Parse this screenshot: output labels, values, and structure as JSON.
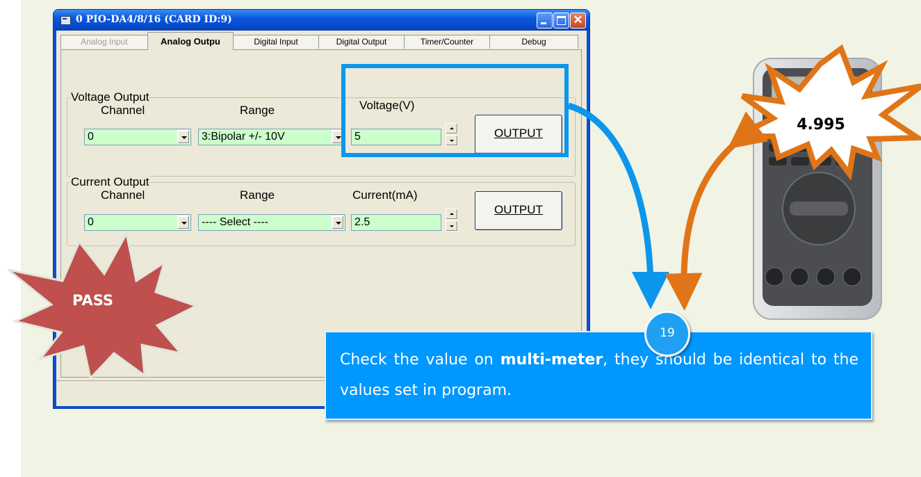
{
  "window": {
    "title": "0 PIO-DA4/8/16 (CARD ID:9)"
  },
  "tabs": [
    {
      "label": "Analog Input",
      "state": "disabled"
    },
    {
      "label": "Analog Outpu",
      "state": "active"
    },
    {
      "label": "Digital Input",
      "state": "normal"
    },
    {
      "label": "Digital Output",
      "state": "normal"
    },
    {
      "label": "Timer/Counter",
      "state": "normal"
    },
    {
      "label": "Debug",
      "state": "normal"
    }
  ],
  "voltage_output": {
    "group_label": "Voltage Output",
    "channel_label": "Channel",
    "channel_value": "0",
    "range_label": "Range",
    "range_value": "3:Bipolar +/-  10V",
    "voltage_label": "Voltage(V)",
    "voltage_value": "5",
    "output_button": "OUTPUT"
  },
  "current_output": {
    "group_label": "Current Output",
    "channel_label": "Channel",
    "channel_value": "0",
    "range_label": "Range",
    "range_value": "---- Select ----",
    "current_label": "Current(mA)",
    "current_value": "2.5",
    "output_button": "OUTPUT"
  },
  "annotation": {
    "pass_label": "PASS",
    "step_number": "19",
    "meter_reading": "4.995",
    "callout_prefix": "Check the value on ",
    "callout_bold": "multi-meter",
    "callout_suffix": ", they should be identical to the values set in program."
  },
  "colors": {
    "background": "#f1f4e5",
    "highlight_blue": "#0c96ec",
    "arrow_orange": "#e07517",
    "pass_red": "#c0504d",
    "callout_blue": "#0097ff",
    "field_green": "#ccffcc"
  }
}
